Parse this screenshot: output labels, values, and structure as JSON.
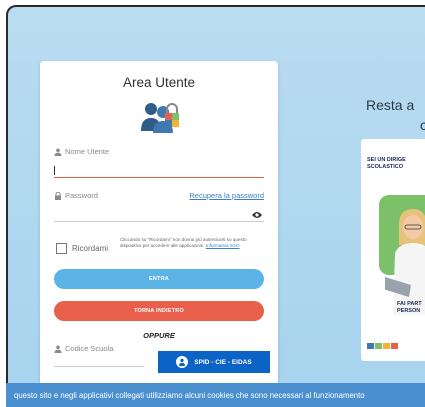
{
  "login": {
    "title": "Area Utente",
    "username_label": "Nome Utente",
    "username_value": "",
    "password_label": "Password",
    "recover_link": "Recupera la password",
    "remember_label": "Ricordami",
    "remember_hint": "Cliccando su \"Ricordami\" non dovrai più autenticarti su questo dispositivo per accedere alle applicazioni.",
    "sso_link": "Informativa SSO",
    "enter_button": "ENTRA",
    "back_button": "TORNA INDIETRO",
    "or_label": "OPPURE",
    "school_code_label": "Codice Scuola",
    "spid_button": "SPID - CIE - EIDAS"
  },
  "side": {
    "tagline_line1": "Resta a",
    "tagline_line2": "c",
    "promo_heading_1": "SEI UN DIRIGE",
    "promo_heading_2": "SCOLASTICO",
    "promo_footer_1": "FAI PART",
    "promo_footer_2": "PERSON"
  },
  "cookie_banner": {
    "text": "questo sito e negli applicativi collegati utilizziamo alcuni cookies che sono necessari al funzionamento"
  },
  "colors": {
    "background": "#b9dcf0",
    "enter_button": "#5bb4e5",
    "back_button": "#e8604c",
    "spid_button": "#0b63c5",
    "cookie_banner": "#4a8fd0"
  },
  "icons": {
    "user": "user-icon",
    "lock": "lock-icon",
    "eye": "eye-icon",
    "spid": "spid-person-icon"
  }
}
